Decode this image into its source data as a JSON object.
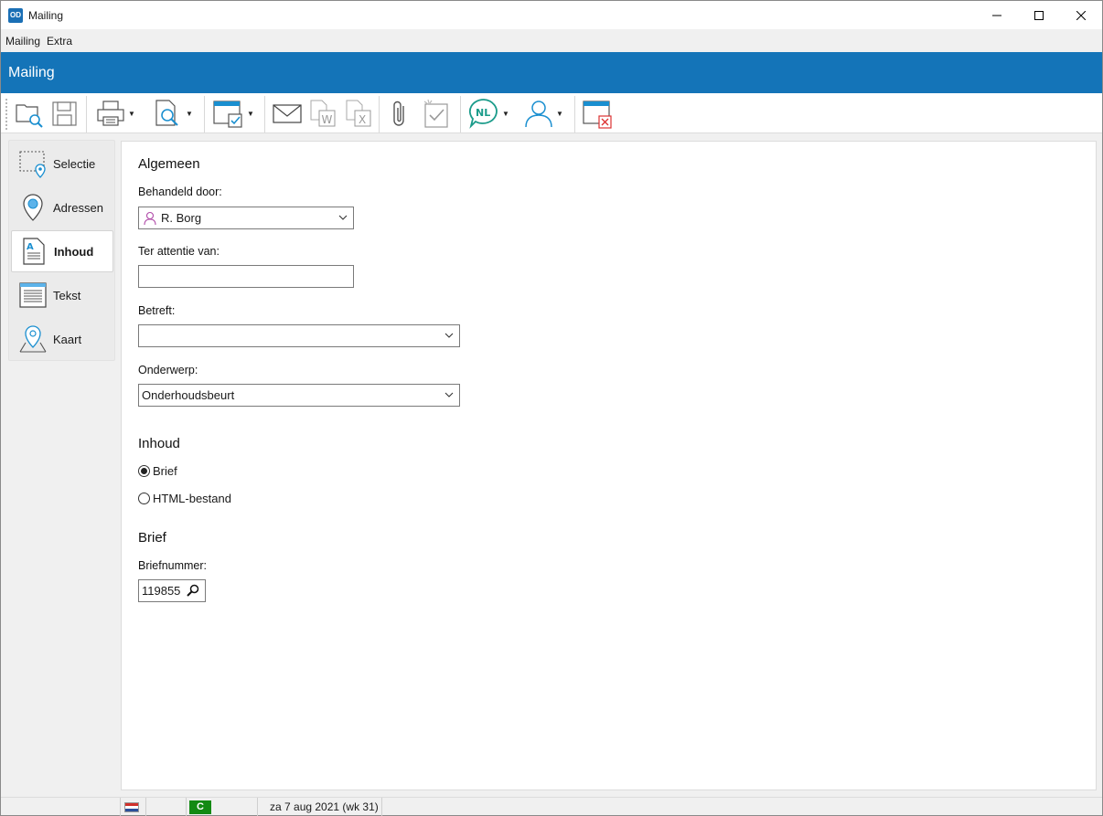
{
  "window": {
    "app_icon": "OD",
    "title": "Mailing",
    "controls": [
      "minimize-icon",
      "maximize-icon",
      "close-icon"
    ]
  },
  "menu": {
    "items": [
      "Mailing",
      "Extra"
    ]
  },
  "header": {
    "title": "Mailing"
  },
  "toolbar": {
    "buttons": [
      "open-icon",
      "save-icon",
      "print-icon",
      "print-preview-icon",
      "select-window-icon",
      "email-icon",
      "export-word-icon",
      "export-excel-icon",
      "attachment-icon",
      "new-clipboard-icon",
      "language-icon",
      "user-icon",
      "close-window-icon"
    ],
    "language_label": "NL"
  },
  "sidenav": {
    "items": [
      {
        "label": "Selectie",
        "icon": "selection-icon"
      },
      {
        "label": "Adressen",
        "icon": "location-pin-icon"
      },
      {
        "label": "Inhoud",
        "icon": "document-icon",
        "active": true
      },
      {
        "label": "Tekst",
        "icon": "text-lines-icon"
      },
      {
        "label": "Kaart",
        "icon": "map-pin-icon"
      }
    ]
  },
  "form": {
    "section_general": "Algemeen",
    "handled_by_label": "Behandeld door:",
    "handled_by_value": "R. Borg",
    "attention_label": "Ter attentie van:",
    "attention_value": "",
    "regarding_label": "Betreft:",
    "regarding_value": "",
    "subject_label": "Onderwerp:",
    "subject_value": "Onderhoudsbeurt",
    "section_content": "Inhoud",
    "radio_letter": "Brief",
    "radio_html": "HTML-bestand",
    "content_choice": "Brief",
    "section_letter": "Brief",
    "letter_number_label": "Briefnummer:",
    "letter_number_value": "119855"
  },
  "statusbar": {
    "language_flag": "NL",
    "status_badge": "C",
    "status_badge_color": "#138a13",
    "date": "za 7 aug 2021 (wk 31)"
  },
  "colors": {
    "header": "#1474b8",
    "accent": "#1a8fd0"
  }
}
